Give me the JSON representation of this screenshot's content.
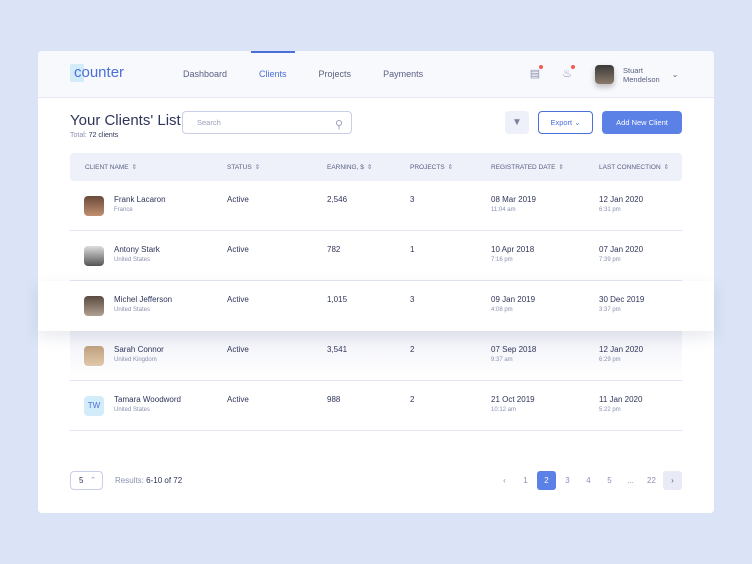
{
  "app": {
    "logo": "counter"
  },
  "nav": [
    "Dashboard",
    "Clients",
    "Projects",
    "Payments"
  ],
  "user": {
    "first": "Stuart",
    "last": "Mendelson"
  },
  "page": {
    "title": "Your Clients' List",
    "total_label": "Total:",
    "total_value": "72 clients"
  },
  "search": {
    "placeholder": "Search"
  },
  "toolbar": {
    "export": "Export",
    "add": "Add New Client"
  },
  "columns": [
    "CLIENT NAME",
    "STATUS",
    "EARNING, $",
    "PROJECTS",
    "REGISTRATED DATE",
    "LAST CONNECTION"
  ],
  "rows": [
    {
      "name": "Frank Lacaron",
      "country": "France",
      "status": "Active",
      "earning": "2,546",
      "projects": "3",
      "reg_date": "08 Mar 2019",
      "reg_time": "11:04 am",
      "last_date": "12 Jan 2020",
      "last_time": "6:31 pm"
    },
    {
      "name": "Antony Stark",
      "country": "United States",
      "status": "Active",
      "earning": "782",
      "projects": "1",
      "reg_date": "10 Apr 2018",
      "reg_time": "7:16 pm",
      "last_date": "07 Jan 2020",
      "last_time": "7:39 pm"
    },
    {
      "name": "Michel Jefferson",
      "country": "United States",
      "status": "Active",
      "earning": "1,015",
      "projects": "3",
      "reg_date": "09 Jan 2019",
      "reg_time": "4:08 pm",
      "last_date": "30 Dec 2019",
      "last_time": "3:37 pm"
    },
    {
      "name": "Sarah Connor",
      "country": "United Kingdom",
      "status": "Active",
      "earning": "3,541",
      "projects": "2",
      "reg_date": "07 Sep 2018",
      "reg_time": "9:37 am",
      "last_date": "12 Jan 2020",
      "last_time": "6:29 pm"
    },
    {
      "name": "Tamara Woodword",
      "initials": "TW",
      "country": "United States",
      "status": "Active",
      "earning": "988",
      "projects": "2",
      "reg_date": "21 Oct 2019",
      "reg_time": "10:12 am",
      "last_date": "11 Jan 2020",
      "last_time": "5:22 pm"
    }
  ],
  "pagination": {
    "per_page": "5",
    "results_label": "Results:",
    "results_value": "6-10 of 72",
    "pages": [
      "1",
      "2",
      "3",
      "4",
      "5",
      "...",
      "22"
    ],
    "current": "2"
  },
  "colors": {
    "accent": "#5b80e6",
    "background": "#dae4f6"
  }
}
